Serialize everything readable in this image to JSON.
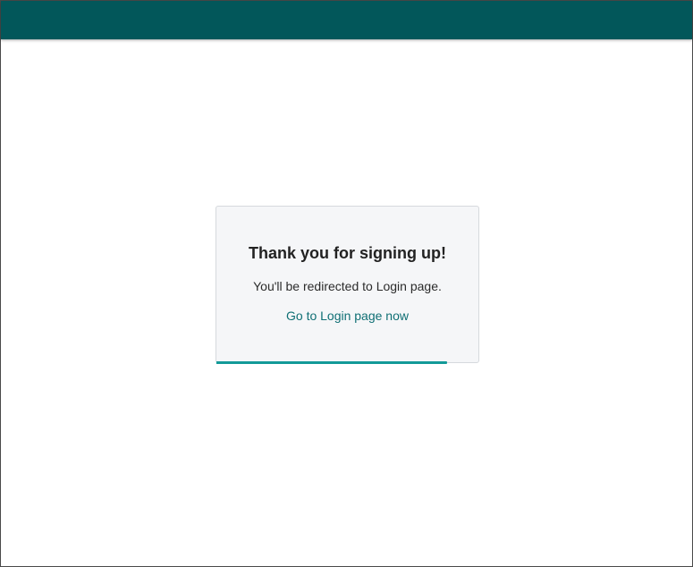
{
  "card": {
    "title": "Thank you for signing up!",
    "message": "You'll be redirected to Login page.",
    "link_label": "Go to Login page now"
  },
  "redirect_progress": 0.88,
  "colors": {
    "header_bar": "#02575a",
    "link": "#0f6f74",
    "progress": "#139a98",
    "card_background": "#f5f6f8"
  }
}
